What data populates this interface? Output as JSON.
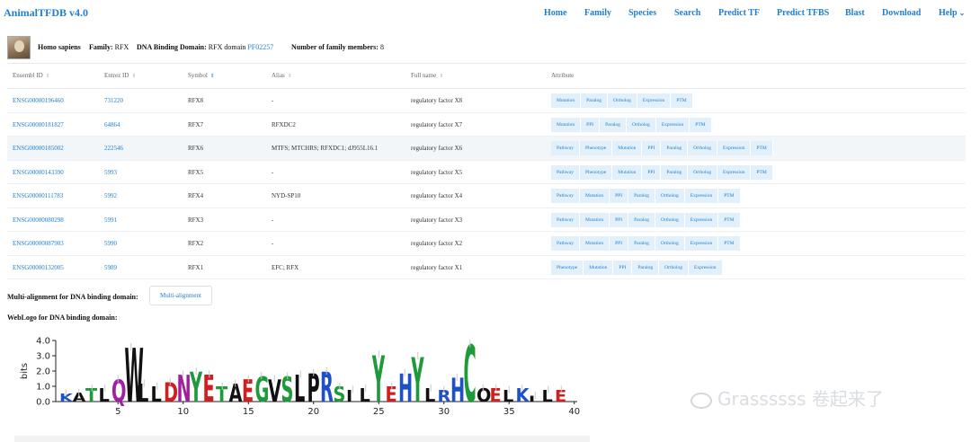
{
  "app": {
    "title": "AnimalTFDB v4.0"
  },
  "nav": {
    "items": [
      "Home",
      "Family",
      "Species",
      "Search",
      "Predict TF",
      "Predict TFBS",
      "Blast",
      "Download",
      "Help"
    ]
  },
  "species": {
    "name": "Homo sapiens",
    "family_label": "Family:",
    "family_value": "RFX",
    "dbd_label": "DNA Binding Domain:",
    "dbd_value": "RFX domain",
    "dbd_link": "PF02257",
    "members_label": "Number of family members:",
    "members_value": "8"
  },
  "table": {
    "columns": [
      "Ensembl ID",
      "Entrez ID",
      "Symbol",
      "Alias",
      "Full name",
      "Attribute"
    ],
    "rows": [
      {
        "ensembl": "ENSG00000196460",
        "entrez": "731220",
        "symbol": "RFX8",
        "alias": "-",
        "fullname": "regulatory factor X8",
        "attrs": [
          "Mutation",
          "Paralog",
          "Ortholog",
          "Expression",
          "PTM"
        ]
      },
      {
        "ensembl": "ENSG00000181827",
        "entrez": "64864",
        "symbol": "RFX7",
        "alias": "RFXDC2",
        "fullname": "regulatory factor X7",
        "attrs": [
          "Mutation",
          "PPI",
          "Paralog",
          "Ortholog",
          "Expression",
          "PTM"
        ]
      },
      {
        "ensembl": "ENSG00000185002",
        "entrez": "222546",
        "symbol": "RFX6",
        "alias": "MTFS; MTCHRS; RFXDC1; dJ955L16.1",
        "fullname": "regulatory factor X6",
        "attrs": [
          "Pathway",
          "Phenotype",
          "Mutation",
          "PPI",
          "Paralog",
          "Ortholog",
          "Expression",
          "PTM"
        ]
      },
      {
        "ensembl": "ENSG00000143390",
        "entrez": "5993",
        "symbol": "RFX5",
        "alias": "-",
        "fullname": "regulatory factor X5",
        "attrs": [
          "Pathway",
          "Phenotype",
          "Mutation",
          "PPI",
          "Paralog",
          "Ortholog",
          "Expression",
          "PTM"
        ]
      },
      {
        "ensembl": "ENSG00000111783",
        "entrez": "5992",
        "symbol": "RFX4",
        "alias": "NYD-SP10",
        "fullname": "regulatory factor X4",
        "attrs": [
          "Pathway",
          "Mutation",
          "PPI",
          "Paralog",
          "Ortholog",
          "Expression",
          "PTM"
        ]
      },
      {
        "ensembl": "ENSG00000080298",
        "entrez": "5991",
        "symbol": "RFX3",
        "alias": "-",
        "fullname": "regulatory factor X3",
        "attrs": [
          "Pathway",
          "Mutation",
          "PPI",
          "Paralog",
          "Ortholog",
          "Expression",
          "PTM"
        ]
      },
      {
        "ensembl": "ENSG00000087903",
        "entrez": "5990",
        "symbol": "RFX2",
        "alias": "-",
        "fullname": "regulatory factor X2",
        "attrs": [
          "Pathway",
          "Mutation",
          "PPI",
          "Paralog",
          "Ortholog",
          "Expression",
          "PTM"
        ]
      },
      {
        "ensembl": "ENSG00000132005",
        "entrez": "5989",
        "symbol": "RFX1",
        "alias": "EFC; RFX",
        "fullname": "regulatory factor X1",
        "attrs": [
          "Phenotype",
          "Mutation",
          "PPI",
          "Paralog",
          "Ortholog",
          "Expression"
        ]
      }
    ]
  },
  "alignment": {
    "label": "Multi-alignment for DNA binding domain:",
    "button": "Multi-alignment"
  },
  "weblogo": {
    "label": "WebLogo for DNA binding domain:",
    "y_label": "bits",
    "y_ticks": [
      "4.0",
      "3.0",
      "2.0",
      "1.0",
      "0.0"
    ],
    "x_ticks": [
      "5",
      "10",
      "15",
      "20",
      "25",
      "30",
      "35",
      "40"
    ],
    "letters": [
      {
        "c": "K",
        "h": 0.55,
        "col": "#1e50c8"
      },
      {
        "c": "A",
        "h": 0.6,
        "col": "#111111"
      },
      {
        "c": "T",
        "h": 0.9,
        "col": "#1e9a3a"
      },
      {
        "c": "L",
        "h": 0.9,
        "col": "#111111"
      },
      {
        "c": "Q",
        "h": 1.5,
        "col": "#a020a0"
      },
      {
        "c": "W",
        "h": 3.6,
        "col": "#111111"
      },
      {
        "c": "L",
        "h": 1.2,
        "col": "#111111"
      },
      {
        "c": "L",
        "h": 1.0,
        "col": "#111111"
      },
      {
        "c": "D",
        "h": 1.3,
        "col": "#d21e1e"
      },
      {
        "c": "N",
        "h": 1.8,
        "col": "#a020a0"
      },
      {
        "c": "Y",
        "h": 2.0,
        "col": "#1e9a3a"
      },
      {
        "c": "E",
        "h": 1.8,
        "col": "#d21e1e"
      },
      {
        "c": "T",
        "h": 1.0,
        "col": "#1e9a3a"
      },
      {
        "c": "A",
        "h": 1.2,
        "col": "#111111"
      },
      {
        "c": "E",
        "h": 1.5,
        "col": "#d21e1e"
      },
      {
        "c": "G",
        "h": 1.7,
        "col": "#1e9a3a"
      },
      {
        "c": "V",
        "h": 1.5,
        "col": "#111111"
      },
      {
        "c": "S",
        "h": 1.7,
        "col": "#1e9a3a"
      },
      {
        "c": "L",
        "h": 1.8,
        "col": "#111111"
      },
      {
        "c": "P",
        "h": 1.9,
        "col": "#111111"
      },
      {
        "c": "R",
        "h": 2.0,
        "col": "#1e50c8"
      },
      {
        "c": "S",
        "h": 1.0,
        "col": "#1e9a3a"
      },
      {
        "c": "I",
        "h": 0.8,
        "col": "#111111"
      },
      {
        "c": "L",
        "h": 0.9,
        "col": "#111111"
      },
      {
        "c": "Y",
        "h": 3.1,
        "col": "#1e9a3a"
      },
      {
        "c": "E",
        "h": 1.0,
        "col": "#d21e1e"
      },
      {
        "c": "H",
        "h": 1.9,
        "col": "#1e50c8"
      },
      {
        "c": "Y",
        "h": 3.0,
        "col": "#1e9a3a"
      },
      {
        "c": "L",
        "h": 0.9,
        "col": "#111111"
      },
      {
        "c": "R",
        "h": 0.8,
        "col": "#1e50c8"
      },
      {
        "c": "H",
        "h": 1.6,
        "col": "#1e50c8"
      },
      {
        "c": "C",
        "h": 3.8,
        "col": "#1e9a3a"
      },
      {
        "c": "O",
        "h": 0.9,
        "col": "#111111"
      },
      {
        "c": "E",
        "h": 0.9,
        "col": "#d21e1e"
      },
      {
        "c": "L",
        "h": 0.8,
        "col": "#111111"
      },
      {
        "c": "K",
        "h": 0.9,
        "col": "#1e50c8"
      },
      {
        "c": "I",
        "h": 0.4,
        "col": "#111111"
      },
      {
        "c": "L",
        "h": 0.8,
        "col": "#111111"
      },
      {
        "c": "E",
        "h": 0.8,
        "col": "#d21e1e"
      }
    ]
  },
  "watermark": {
    "text": "Grassssss 卷起来了"
  }
}
